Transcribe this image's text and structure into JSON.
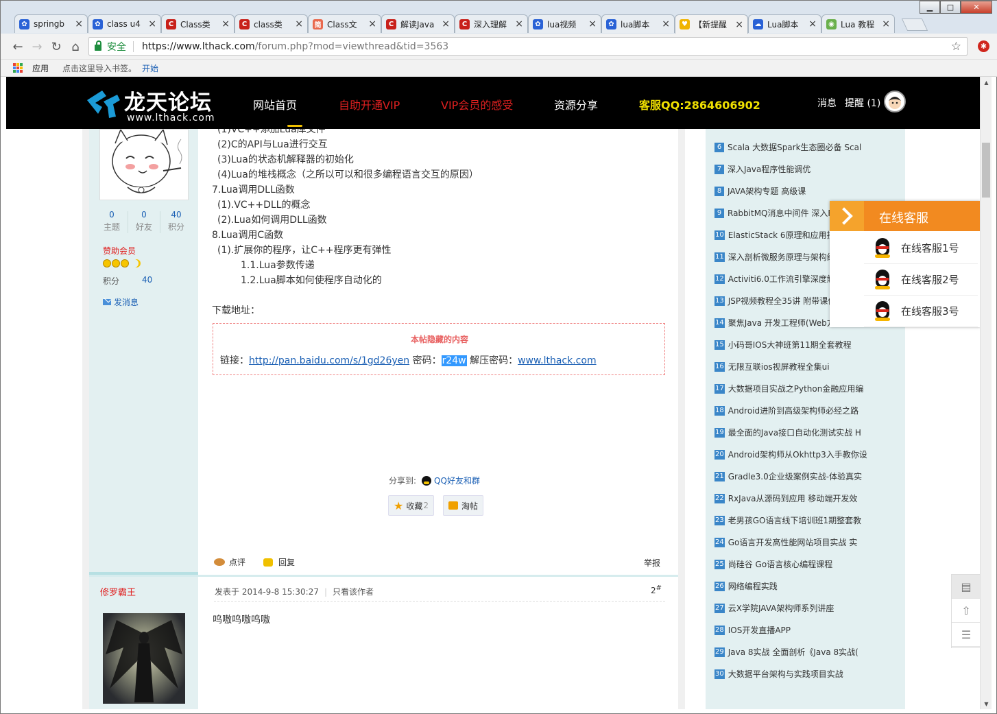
{
  "tabs": [
    {
      "title": "springb",
      "favicon": "baidu-paw-icon",
      "color": "#2a62d6"
    },
    {
      "title": "class u4",
      "favicon": "baidu-paw-icon",
      "color": "#2a62d6"
    },
    {
      "title": "Class类",
      "favicon": "csdn-c-icon",
      "color": "#c8201a"
    },
    {
      "title": "class类",
      "favicon": "csdn-c-icon",
      "color": "#c8201a"
    },
    {
      "title": "Class文",
      "favicon": "jianshu-icon",
      "color": "#e9694e"
    },
    {
      "title": "解读Java",
      "favicon": "csdn-c-icon",
      "color": "#c8201a"
    },
    {
      "title": "深入理解",
      "favicon": "csdn-c-icon",
      "color": "#c8201a"
    },
    {
      "title": "lua视频",
      "favicon": "baidu-paw-icon",
      "color": "#2a62d6"
    },
    {
      "title": "lua脚本",
      "favicon": "baidu-paw-icon",
      "color": "#2a62d6"
    },
    {
      "title": "【新提醒",
      "favicon": "bell-icon",
      "color": "#f0b400",
      "active": true
    },
    {
      "title": "Lua脚本",
      "favicon": "cloud-icon",
      "color": "#2a62d6"
    },
    {
      "title": "Lua 教程",
      "favicon": "runoob-icon",
      "color": "#6ab04c"
    }
  ],
  "toolbar": {
    "secure_label": "安全",
    "url_host": "https://www.lthack.com",
    "url_path": "/forum.php?mod=viewthread&tid=3563"
  },
  "bookmarks": {
    "apps": "应用",
    "import_hint": "点击这里导入书签。",
    "start": "开始"
  },
  "site": {
    "logo_title": "龙天论坛",
    "logo_sub": "www.lthack.com",
    "nav": [
      {
        "label": "网站首页",
        "style": "white"
      },
      {
        "label": "自助开通VIP",
        "style": "red"
      },
      {
        "label": "VIP会员的感受",
        "style": "red"
      },
      {
        "label": "资源分享",
        "style": "white"
      },
      {
        "label": "客服QQ:2864606902",
        "style": "yellow"
      }
    ],
    "messages": "消息",
    "remind": "提醒 (1)"
  },
  "user1": {
    "stats": [
      {
        "num": "0",
        "label": "主题"
      },
      {
        "num": "0",
        "label": "好友"
      },
      {
        "num": "40",
        "label": "积分"
      }
    ],
    "group": "赞助会员",
    "points_label": "积分",
    "points_value": "40",
    "send_msg": "发消息"
  },
  "post": {
    "lines": [
      "(1)VC++添加Lua库文件",
      "(2)C的API与Lua进行交互",
      "(3)Lua的状态机解释器的初始化",
      "(4)Lua的堆栈概念（之所以可以和很多编程语言交互的原因）",
      "7.Lua调用DLL函数",
      "(1).VC++DLL的概念",
      "(2).Lua如何调用DLL函数",
      "8.Lua调用C函数",
      "(1).扩展你的程序，让C++程序更有弹性",
      "1.1.Lua参数传递",
      "1.2.Lua脚本如何使程序自动化的",
      "下载地址："
    ],
    "hidden_title": "本帖隐藏的内容",
    "link_label": "链接：",
    "link_url": "http://pan.baidu.com/s/1gd26yen",
    "pwd_label": " 密码：",
    "pwd_value": "r24w",
    "unzip_label": " 解压密码：",
    "unzip_value": "www.lthack.com",
    "share_label": "分享到:",
    "share_target": "QQ好友和群",
    "fav_label": "收藏",
    "fav_count": "2",
    "tao_label": "淘帖",
    "comment_label": "点评",
    "reply_label": "回复",
    "report_label": "举报"
  },
  "reply2": {
    "author": "修罗霸王",
    "posted": "发表于 2014-9-8 15:30:27",
    "only_author": "只看该作者",
    "floor": "2",
    "floor_sup": "#",
    "content": "呜嗷呜嗷呜嗷"
  },
  "sidebar": {
    "items": [
      {
        "n": "6",
        "title": "Scala 大数据Spark生态圈必备 Scal"
      },
      {
        "n": "7",
        "title": "深入Java程序性能调优"
      },
      {
        "n": "8",
        "title": "JAVA架构专题 高级课"
      },
      {
        "n": "9",
        "title": "RabbitMQ消息中间件 深入R"
      },
      {
        "n": "10",
        "title": "ElasticStack 6原理和应用技巧 数"
      },
      {
        "n": "11",
        "title": "深入剖析微服务原理与架构细节 Spr"
      },
      {
        "n": "12",
        "title": "Activiti6.0工作流引擎深度解析与"
      },
      {
        "n": "13",
        "title": "JSP视频教程全35讲 附带课件"
      },
      {
        "n": "14",
        "title": "聚焦Java 开发工程师(Web方向)必知"
      },
      {
        "n": "15",
        "title": "小码哥IOS大神班第11期全套教程"
      },
      {
        "n": "16",
        "title": "无限互联ios视屏教程全集ui"
      },
      {
        "n": "17",
        "title": "大数据项目实战之Python金融应用编"
      },
      {
        "n": "18",
        "title": "Android进阶到高级架构师必经之路"
      },
      {
        "n": "19",
        "title": "最全面的Java接口自动化测试实战 H"
      },
      {
        "n": "20",
        "title": "Android架构师从Okhttp3入手教你设"
      },
      {
        "n": "21",
        "title": "Gradle3.0企业级案例实战-体验真实"
      },
      {
        "n": "22",
        "title": "RxJava从源码到应用 移动端开发效"
      },
      {
        "n": "23",
        "title": "老男孩GO语言线下培训班1期整套教"
      },
      {
        "n": "24",
        "title": "Go语言开发高性能网站项目实战 实"
      },
      {
        "n": "25",
        "title": "尚硅谷 Go语言核心编程课程"
      },
      {
        "n": "26",
        "title": "网络编程实践"
      },
      {
        "n": "27",
        "title": "云X学院JAVA架构师系列讲座"
      },
      {
        "n": "28",
        "title": "IOS开发直播APP"
      },
      {
        "n": "29",
        "title": "Java 8实战 全面剖析《Java 8实战("
      },
      {
        "n": "30",
        "title": "大数据平台架构与实践项目实战"
      }
    ]
  },
  "kefu": {
    "title": "在线客服",
    "items": [
      "在线客服1号",
      "在线客服2号",
      "在线客服3号"
    ]
  }
}
